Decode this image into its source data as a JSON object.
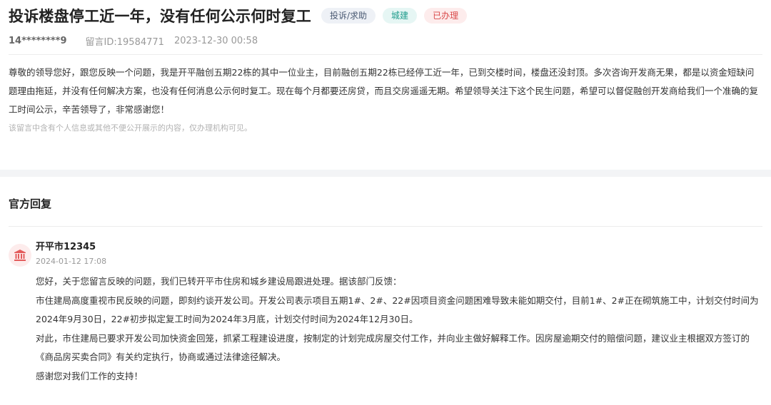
{
  "post": {
    "title": "投诉楼盘停工近一年，没有任何公示何时复工",
    "tags": [
      "投诉/求助",
      "城建",
      "已办理"
    ],
    "user": "14********9",
    "message_id": "留言ID:19584771",
    "datetime": "2023-12-30 00:58",
    "content": "尊敬的领导您好，跟您反映一个问题，我是开平融创五期22栋的其中一位业主，目前融创五期22栋已经停工近一年，已到交楼时间，楼盘还没封顶。多次咨询开发商无果，都是以资金短缺问题理由拖延，并没有任何解决方案，也没有任何消息公示何时复工。现在每个月都要还房贷，而且交房遥遥无期。希望领导关注下这个民生问题，希望可以督促融创开发商给我们一个准确的复工时间公示，辛苦领导了，非常感谢您！",
    "privacy_note": "该留言中含有个人信息或其他不便公开展示的内容，仅办理机构可见。"
  },
  "reply": {
    "section_title": "官方回复",
    "org_name": "开平市12345",
    "org_date": "2024-01-12 17:08",
    "paragraphs": [
      "您好，关于您留言反映的问题，我们已转开平市住房和城乡建设局跟进处理。据该部门反馈：",
      "市住建局高度重视市民反映的问题，即刻约谈开发公司。开发公司表示项目五期1#、2#、22#因项目资金问题困难导致未能如期交付，目前1#、2#正在砌筑施工中，计划交付时间为2024年9月30日，22#初步拟定复工时间为2024年3月底，计划交付时间为2024年12月30日。",
      "对此，市住建局已要求开发公司加快资金回笼，抓紧工程建设进度，按制定的计划完成房屋交付工作，并向业主做好解释工作。因房屋逾期交付的赔偿问题，建议业主根据双方签订的《商品房买卖合同》有关约定执行，协商或通过法律途径解决。",
      "感谢您对我们工作的支持！"
    ]
  },
  "icons": {
    "org_avatar": "government-building-icon"
  },
  "colors": {
    "tag_gray_bg": "#eef1f6",
    "tag_teal_text": "#1f9c8c",
    "tag_red_text": "#d94a4a",
    "avatar_bg": "#fdecec",
    "avatar_icon": "#e35b5b"
  }
}
